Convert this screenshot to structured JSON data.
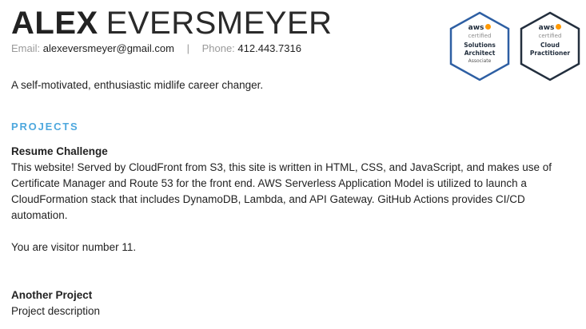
{
  "header": {
    "first_name": "ALEX",
    "last_name": "EVERSMEYER",
    "email_label": "Email:",
    "email": "alexeversmeyer@gmail.com",
    "separator": "|",
    "phone_label": "Phone:",
    "phone": "412.443.7316"
  },
  "badges": [
    {
      "icon": "aws-certified-badge",
      "brand": "aws",
      "certified": "certified",
      "role_line1": "Solutions",
      "role_line2": "Architect",
      "level": "Associate",
      "border_color": "#2e5fa3"
    },
    {
      "icon": "aws-certified-badge",
      "brand": "aws",
      "certified": "certified",
      "role_line1": "Cloud",
      "role_line2": "Practitioner",
      "border_color": "#232f3e"
    }
  ],
  "tagline": "A self-motivated, enthusiastic midlife career changer.",
  "projects_section": {
    "title": "PROJECTS",
    "projects": [
      {
        "title": "Resume Challenge",
        "description": "This website! Served by CloudFront from S3, this site is written in HTML, CSS, and JavaScript, and makes use of Certificate Manager and Route 53 for the front end. AWS Serverless Application Model is utilized to launch a CloudFormation stack that includes DynamoDB, Lambda, and API Gateway. GitHub Actions provides CI/CD automation."
      },
      {
        "title": "Another Project",
        "description": "Project description"
      }
    ],
    "visitor_text": "You are visitor number 11."
  },
  "colors": {
    "accent": "#4ea8de",
    "aws_orange": "#ff9900",
    "text": "#222222",
    "muted": "#9a9a9a"
  }
}
